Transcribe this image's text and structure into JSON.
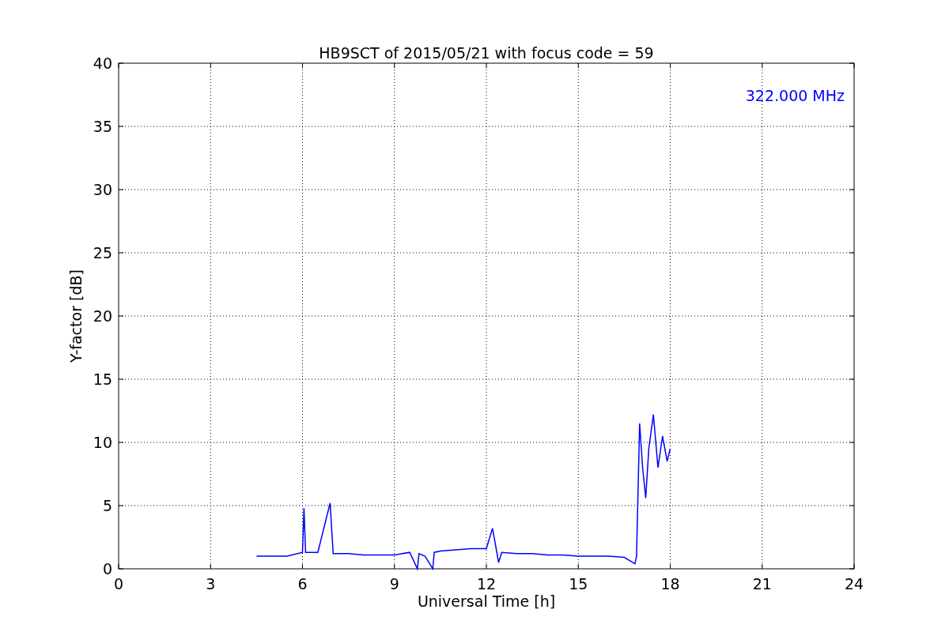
{
  "chart_data": {
    "type": "line",
    "title": "HB9SCT of 2015/05/21 with focus code = 59",
    "xlabel": "Universal Time [h]",
    "ylabel": "Y-factor [dB]",
    "xlim": [
      0,
      24
    ],
    "ylim": [
      0,
      40
    ],
    "xticks": [
      0,
      3,
      6,
      9,
      12,
      15,
      18,
      21,
      24
    ],
    "yticks": [
      0,
      5,
      10,
      15,
      20,
      25,
      30,
      35,
      40
    ],
    "x": [
      4.5,
      4.7,
      5.0,
      5.5,
      6.0,
      6.05,
      6.1,
      6.5,
      6.9,
      7.0,
      7.5,
      8.0,
      8.5,
      9.0,
      9.5,
      9.75,
      9.8,
      10.0,
      10.25,
      10.3,
      10.5,
      11.0,
      11.5,
      12.0,
      12.2,
      12.4,
      12.5,
      13.0,
      13.5,
      14.0,
      14.5,
      15.0,
      15.5,
      16.0,
      16.5,
      16.85,
      16.9,
      17.0,
      17.1,
      17.2,
      17.3,
      17.45,
      17.6,
      17.75,
      17.9,
      18.0
    ],
    "series": [
      {
        "name": "322.000 MHz",
        "color": "#0000ff",
        "values": [
          1.0,
          1.0,
          1.0,
          1.0,
          1.3,
          4.8,
          1.3,
          1.3,
          5.2,
          1.2,
          1.2,
          1.1,
          1.1,
          1.1,
          1.3,
          0.0,
          1.2,
          1.0,
          0.0,
          1.3,
          1.4,
          1.5,
          1.6,
          1.6,
          3.2,
          0.5,
          1.3,
          1.2,
          1.2,
          1.1,
          1.1,
          1.0,
          1.0,
          1.0,
          0.9,
          0.4,
          1.0,
          11.5,
          8.0,
          5.6,
          9.5,
          12.2,
          8.0,
          10.5,
          8.5,
          9.5
        ]
      }
    ],
    "grid": true
  }
}
